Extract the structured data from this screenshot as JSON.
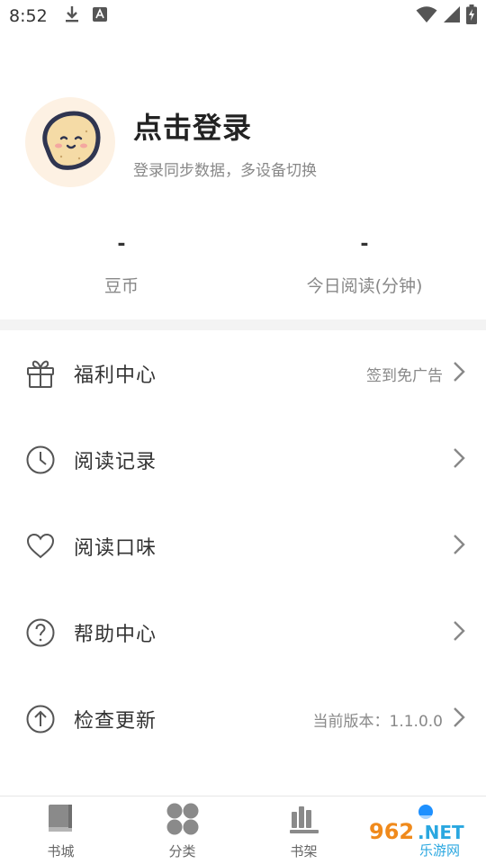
{
  "status_bar": {
    "time": "8:52",
    "left_icons": [
      "download-icon",
      "keyboard-icon"
    ],
    "right_icons": [
      "wifi-icon",
      "signal-icon",
      "battery-icon"
    ]
  },
  "profile": {
    "title": "点击登录",
    "subtitle": "登录同步数据，多设备切换",
    "avatar_icon": "potato-avatar-icon"
  },
  "stats": [
    {
      "value": "-",
      "label": "豆币"
    },
    {
      "value": "-",
      "label": "今日阅读(分钟)"
    }
  ],
  "menu": [
    {
      "icon": "gift-icon",
      "label": "福利中心",
      "hint": "签到免广告"
    },
    {
      "icon": "clock-icon",
      "label": "阅读记录",
      "hint": ""
    },
    {
      "icon": "heart-icon",
      "label": "阅读口味",
      "hint": ""
    },
    {
      "icon": "help-icon",
      "label": "帮助中心",
      "hint": ""
    },
    {
      "icon": "upgrade-icon",
      "label": "检查更新",
      "hint": "当前版本：1.1.0.0"
    }
  ],
  "tabbar": [
    {
      "icon": "book-icon",
      "label": "书城"
    },
    {
      "icon": "category-icon",
      "label": "分类"
    },
    {
      "icon": "bookshelf-icon",
      "label": "书架"
    },
    {
      "icon": "profile-icon",
      "label": ""
    }
  ],
  "watermark": {
    "brand": "962.NET",
    "sub": "乐游网"
  },
  "colors": {
    "accent": "#1e90ff",
    "avatar_bg": "#fdf1e3",
    "icon_grey": "#555555",
    "hint_grey": "#888888"
  }
}
